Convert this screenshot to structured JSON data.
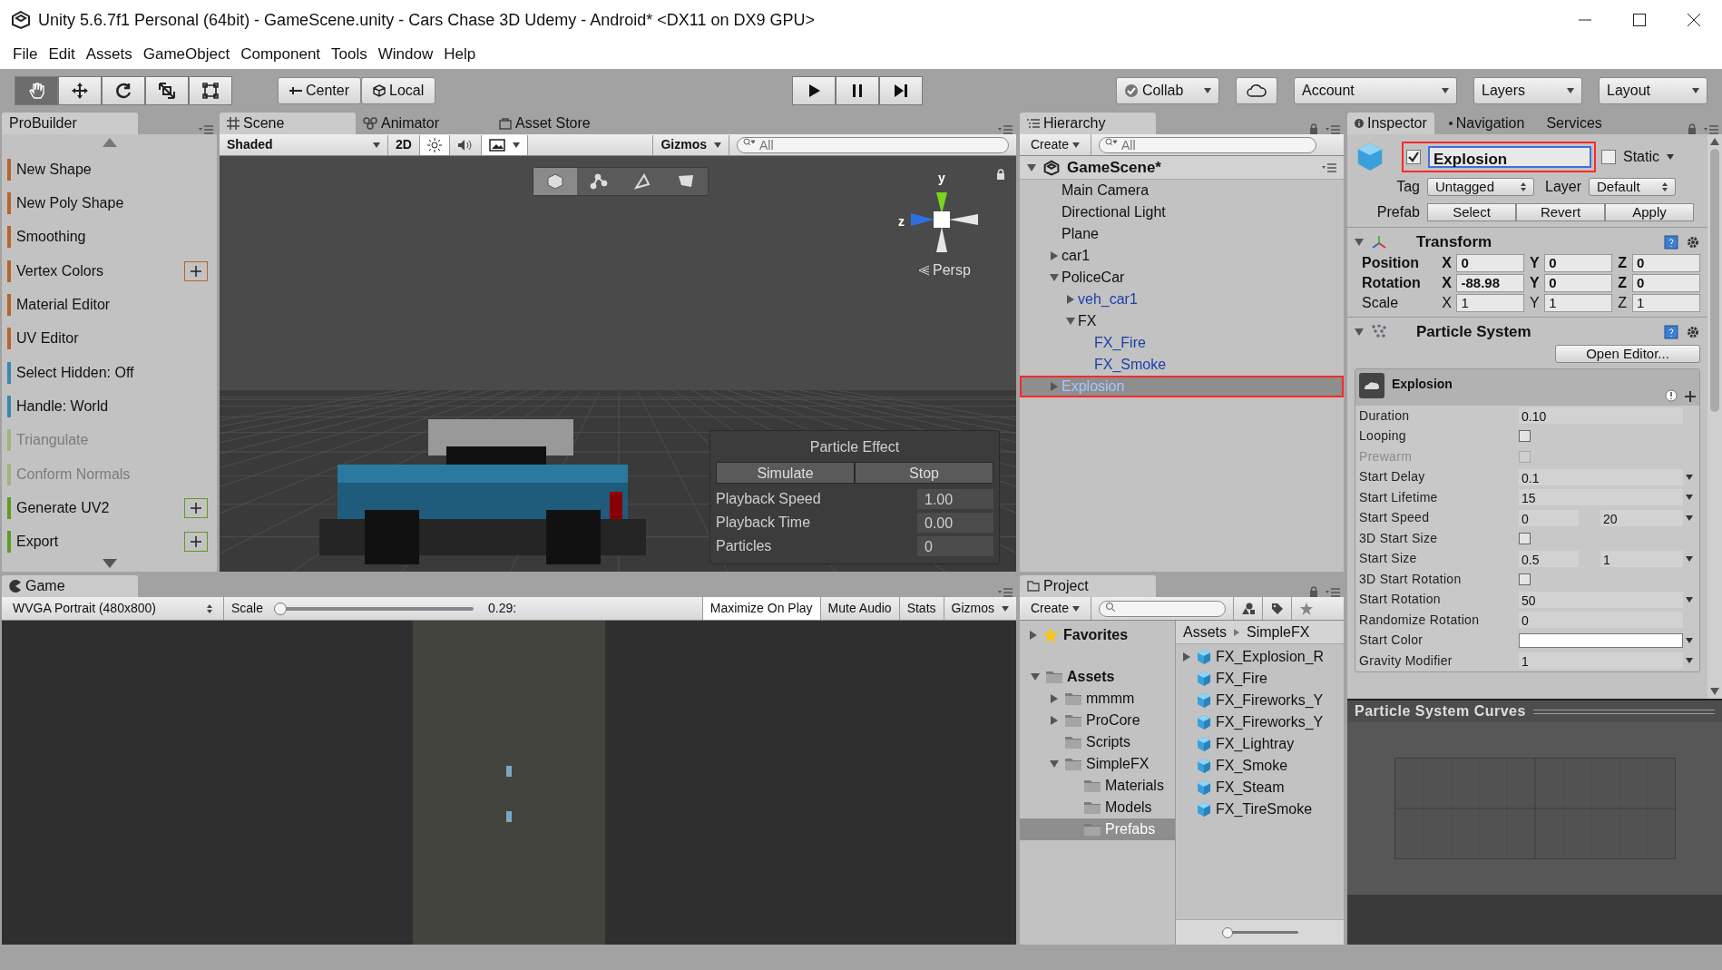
{
  "window": {
    "title": "Unity 5.6.7f1 Personal (64bit) - GameScene.unity - Cars Chase 3D Udemy - Android* <DX11 on DX9 GPU>"
  },
  "menu": [
    "File",
    "Edit",
    "Assets",
    "GameObject",
    "Component",
    "Tools",
    "Window",
    "Help"
  ],
  "toolbar": {
    "tools": [
      {
        "kind": "hand",
        "selected": true
      },
      {
        "kind": "move",
        "selected": false
      },
      {
        "kind": "rotate",
        "selected": false
      },
      {
        "kind": "scale",
        "selected": false
      },
      {
        "kind": "rect",
        "selected": false
      }
    ],
    "pivot": [
      {
        "kind": "pivot",
        "label": "Center"
      },
      {
        "kind": "space",
        "label": "Local"
      }
    ],
    "playback": [
      {
        "kind": "play"
      },
      {
        "kind": "pause"
      },
      {
        "kind": "step"
      }
    ],
    "collab": "Collab",
    "account": "Account",
    "layers": "Layers",
    "layout": "Layout"
  },
  "probuilder": {
    "tab": "ProBuilder",
    "items": [
      {
        "label": "New Shape",
        "color": "#b5652b",
        "disabled": false,
        "options": false
      },
      {
        "label": "New Poly Shape",
        "color": "#b5652b",
        "disabled": false,
        "options": false
      },
      {
        "label": "Smoothing",
        "color": "#b5652b",
        "disabled": false,
        "options": false
      },
      {
        "label": "Vertex Colors",
        "color": "#b5652b",
        "disabled": false,
        "options": true
      },
      {
        "label": "Material Editor",
        "color": "#b5652b",
        "disabled": false,
        "options": false
      },
      {
        "label": "UV Editor",
        "color": "#b5652b",
        "disabled": false,
        "options": false
      },
      {
        "label": "Select Hidden: Off",
        "color": "#3a87b4",
        "disabled": false,
        "options": false
      },
      {
        "label": "Handle: World",
        "color": "#3a87b4",
        "disabled": false,
        "options": false
      },
      {
        "label": "Triangulate",
        "color": "#9cb77f",
        "disabled": true,
        "options": false
      },
      {
        "label": "Conform Normals",
        "color": "#9cb77f",
        "disabled": true,
        "options": false
      },
      {
        "label": "Generate UV2",
        "color": "#5d9c22",
        "disabled": false,
        "options": true
      },
      {
        "label": "Export",
        "color": "#5d9c22",
        "disabled": false,
        "options": true
      }
    ]
  },
  "scene": {
    "tabs": [
      {
        "label": "Scene",
        "kind": "scene",
        "selected": true
      },
      {
        "label": "Animator",
        "kind": "animator",
        "selected": false
      },
      {
        "label": "Asset Store",
        "kind": "store",
        "selected": false
      }
    ],
    "shading": "Shaded",
    "mode_2d": "2D",
    "lighting": true,
    "audio": false,
    "effects": true,
    "gizmos": "Gizmos",
    "search": {
      "placeholder": "All"
    },
    "axis_labels": [
      "y",
      "z"
    ],
    "projection": "Persp",
    "particle_effect": {
      "title": "Particle Effect",
      "buttons": [
        "Simulate",
        "Stop"
      ],
      "rows": [
        {
          "label": "Playback Speed",
          "value": "1.00"
        },
        {
          "label": "Playback Time",
          "value": "0.00"
        },
        {
          "label": "Particles",
          "value": "0"
        }
      ]
    }
  },
  "game": {
    "tab": "Game",
    "resolution": "WVGA Portrait (480x800)",
    "scale": {
      "label": "Scale",
      "level": 0,
      "reading": "0.29:"
    },
    "toggles": [
      {
        "label": "Maximize On Play",
        "on": true
      },
      {
        "label": "Mute Audio",
        "on": false
      },
      {
        "label": "Stats",
        "on": false
      },
      {
        "label": "Gizmos",
        "on": false
      }
    ]
  },
  "hierarchy": {
    "tab": "Hierarchy",
    "create": "Create",
    "search": {
      "placeholder": "All"
    },
    "scene": "GameScene*",
    "items": [
      {
        "label": "Main Camera",
        "prefab": false,
        "selected": false,
        "annotated": false
      },
      {
        "label": "Directional Light",
        "prefab": false,
        "selected": false,
        "annotated": false
      },
      {
        "label": "Plane",
        "prefab": false,
        "selected": false,
        "annotated": false
      },
      {
        "label": "car1",
        "expanded": false,
        "prefab": false,
        "selected": false,
        "annotated": false
      },
      {
        "label": "PoliceCar",
        "expanded": true,
        "prefab": false,
        "selected": false,
        "annotated": false,
        "children": [
          {
            "label": "veh_car1",
            "expanded": false,
            "prefab": true,
            "selected": false,
            "annotated": false
          },
          {
            "label": "FX",
            "expanded": true,
            "prefab": false,
            "selected": false,
            "annotated": false,
            "children": [
              {
                "label": "FX_Fire",
                "prefab": true,
                "selected": false,
                "annotated": false
              },
              {
                "label": "FX_Smoke",
                "prefab": true,
                "selected": false,
                "annotated": false
              }
            ]
          }
        ]
      },
      {
        "label": "Explosion",
        "expanded": false,
        "prefab": true,
        "selected": true,
        "annotated": true
      }
    ]
  },
  "inspector": {
    "tabs": [
      {
        "label": "Inspector",
        "selected": true
      },
      {
        "label": "Navigation",
        "selected": false
      },
      {
        "label": "Services",
        "selected": false
      }
    ],
    "active": true,
    "name": "Explosion",
    "name_annotated": true,
    "static_label": "Static",
    "static": false,
    "tag_label": "Tag",
    "tag": "Untagged",
    "layer_label": "Layer",
    "layer": "Default",
    "prefab_label": "Prefab",
    "prefab_buttons": [
      "Select",
      "Revert",
      "Apply"
    ],
    "transform": {
      "title": "Transform",
      "expanded": true,
      "rows": [
        {
          "label": "Position",
          "modified": true,
          "axes": [
            "X",
            "Y",
            "Z"
          ],
          "values": [
            "0",
            "0",
            "0"
          ]
        },
        {
          "label": "Rotation",
          "modified": true,
          "axes": [
            "X",
            "Y",
            "Z"
          ],
          "values": [
            "-88.98",
            "0",
            "0"
          ]
        },
        {
          "label": "Scale",
          "modified": false,
          "axes": [
            "X",
            "Y",
            "Z"
          ],
          "values": [
            "1",
            "1",
            "1"
          ]
        }
      ]
    },
    "particle_system": {
      "title": "Particle System",
      "expanded": true,
      "open_editor": "Open Editor...",
      "module": "Explosion",
      "rows": [
        {
          "kind": "value",
          "label": "Duration",
          "value": "0.10",
          "menu": false,
          "disabled": false
        },
        {
          "kind": "check",
          "label": "Looping",
          "checked": false,
          "disabled": false
        },
        {
          "kind": "check",
          "label": "Prewarm",
          "checked": false,
          "disabled": true
        },
        {
          "kind": "value",
          "label": "Start Delay",
          "value": "0.1",
          "menu": true,
          "disabled": false
        },
        {
          "kind": "value",
          "label": "Start Lifetime",
          "value": "15",
          "menu": true,
          "disabled": false
        },
        {
          "kind": "range",
          "label": "Start Speed",
          "min": "0",
          "max": "20",
          "disabled": false
        },
        {
          "kind": "check",
          "label": "3D Start Size",
          "checked": false,
          "disabled": false
        },
        {
          "kind": "range",
          "label": "Start Size",
          "min": "0.5",
          "max": "1",
          "disabled": false
        },
        {
          "kind": "check",
          "label": "3D Start Rotation",
          "checked": false,
          "disabled": false
        },
        {
          "kind": "value",
          "label": "Start Rotation",
          "value": "50",
          "menu": true,
          "disabled": false
        },
        {
          "kind": "value",
          "label": "Randomize Rotation",
          "value": "0",
          "menu": false,
          "disabled": false
        },
        {
          "kind": "color",
          "label": "Start Color",
          "color": "#ffffff",
          "disabled": false
        },
        {
          "kind": "value",
          "label": "Gravity Modifier",
          "value": "1",
          "menu": true,
          "disabled": false
        }
      ]
    },
    "curves": {
      "title": "Particle System Curves"
    }
  },
  "project": {
    "tab": "Project",
    "create": "Create",
    "favorites": "Favorites",
    "tree": [
      {
        "label": "Assets",
        "expanded": true,
        "selected": false,
        "children": [
          {
            "label": "mmmm",
            "expanded": false,
            "selected": false
          },
          {
            "label": "ProCore",
            "expanded": false,
            "selected": false
          },
          {
            "label": "Scripts",
            "selected": false
          },
          {
            "label": "SimpleFX",
            "expanded": true,
            "selected": false,
            "children": [
              {
                "label": "Materials",
                "selected": false
              },
              {
                "label": "Models",
                "selected": false
              },
              {
                "label": "Prefabs",
                "selected": true
              }
            ]
          }
        ]
      }
    ],
    "breadcrumb": [
      "Assets",
      "SimpleFX"
    ],
    "files": [
      {
        "label": "FX_Explosion_R",
        "expanded": false
      },
      {
        "label": "FX_Fire"
      },
      {
        "label": "FX_Fireworks_Y"
      },
      {
        "label": "FX_Fireworks_Y"
      },
      {
        "label": "FX_Lightray"
      },
      {
        "label": "FX_Smoke"
      },
      {
        "label": "FX_Steam"
      },
      {
        "label": "FX_TireSmoke"
      }
    ],
    "icon_size": {
      "level": 0
    }
  }
}
